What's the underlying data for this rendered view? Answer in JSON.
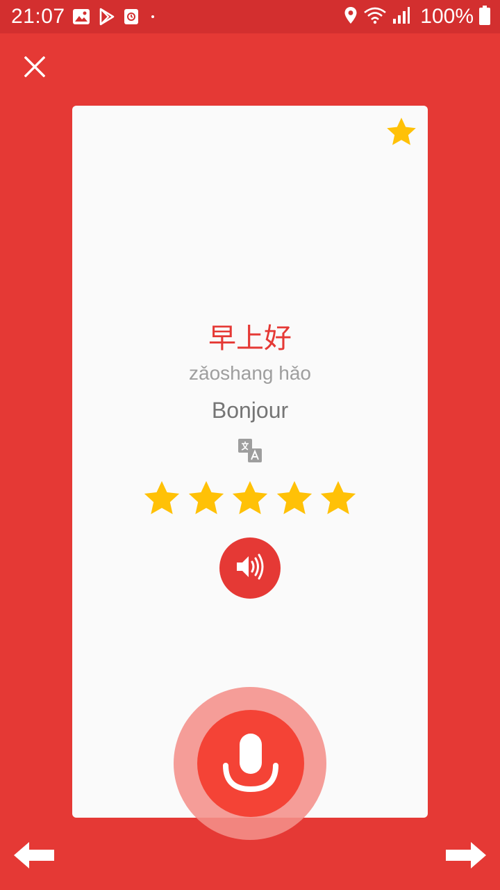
{
  "status_bar": {
    "time": "21:07",
    "battery": "100%",
    "icons": [
      "gallery-icon",
      "play-store-icon",
      "screen-recorder-icon",
      "notification-dot",
      "location-icon",
      "wifi-icon",
      "signal-icon",
      "battery-icon"
    ]
  },
  "toolbar": {
    "close_icon": "close-icon"
  },
  "card": {
    "favorite_icon": "star-icon",
    "hanzi": "早上好",
    "pinyin": "zǎoshang hǎo",
    "translation": "Bonjour",
    "translate_icon": "translate-icon",
    "rating": {
      "value": 5,
      "max": 5
    },
    "audio_icon": "speaker-icon"
  },
  "record": {
    "icon": "microphone-icon"
  },
  "navigation": {
    "prev_icon": "arrow-left-icon",
    "next_icon": "arrow-right-icon"
  },
  "colors": {
    "background": "#e53935",
    "status_bar": "#d32f2f",
    "card": "#fafafa",
    "accent_red": "#e53935",
    "star_gold": "#ffc107",
    "pinyin_gray": "#9e9e9e",
    "translation_gray": "#757575",
    "mic_halo": "#f48f8a",
    "mic_button": "#f44336"
  }
}
